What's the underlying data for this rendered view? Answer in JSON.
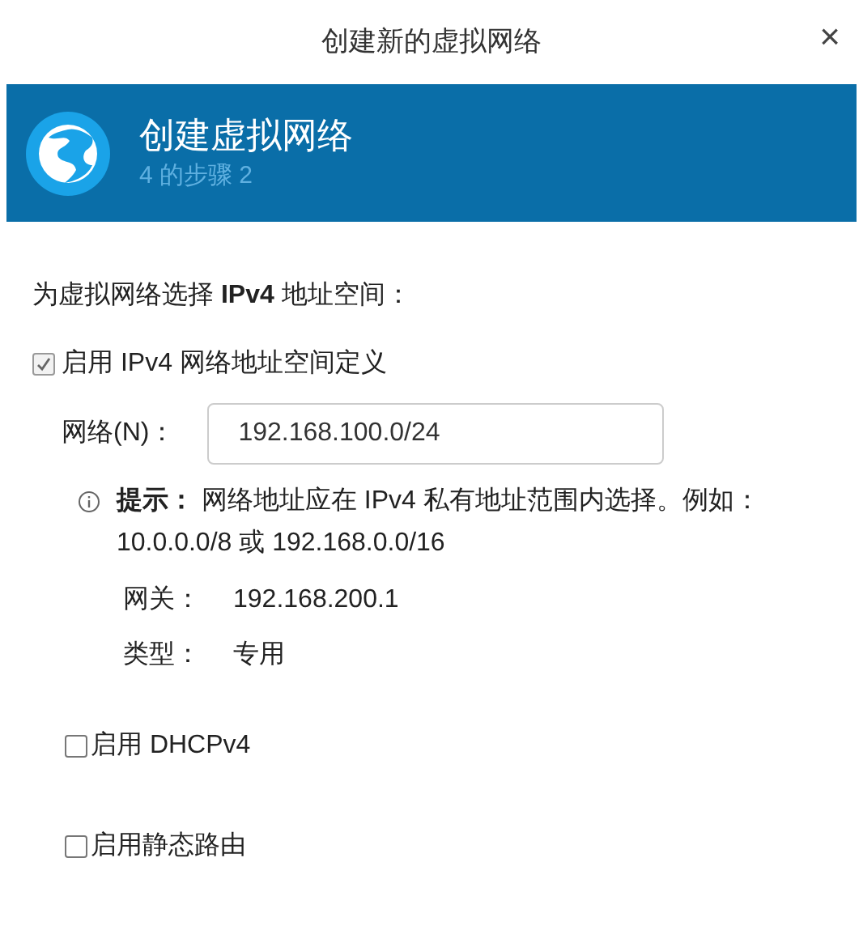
{
  "window": {
    "title": "创建新的虚拟网络",
    "close": "×"
  },
  "banner": {
    "title": "创建虚拟网络",
    "step": "4 的步骤 2"
  },
  "heading": "为虚拟网络选择 **IPv4** 地址空间：",
  "ipv4_enable": {
    "label": "启用 IPv4 网络地址空间定义",
    "checked": true
  },
  "network": {
    "label": "网络(N)：",
    "value": "192.168.100.0/24"
  },
  "hint": "**提示：** 网络地址应在 IPv4 私有地址范围内选择。例如：10.0.0.0/8 或 192.168.0.0/16",
  "details": [
    {
      "label": "网关：",
      "value": "192.168.200.1"
    },
    {
      "label": "类型：",
      "value": "专用"
    }
  ],
  "options": [
    {
      "label": "启用 DHCPv4",
      "checked": false
    },
    {
      "label": "启用静态路由",
      "checked": false
    }
  ]
}
